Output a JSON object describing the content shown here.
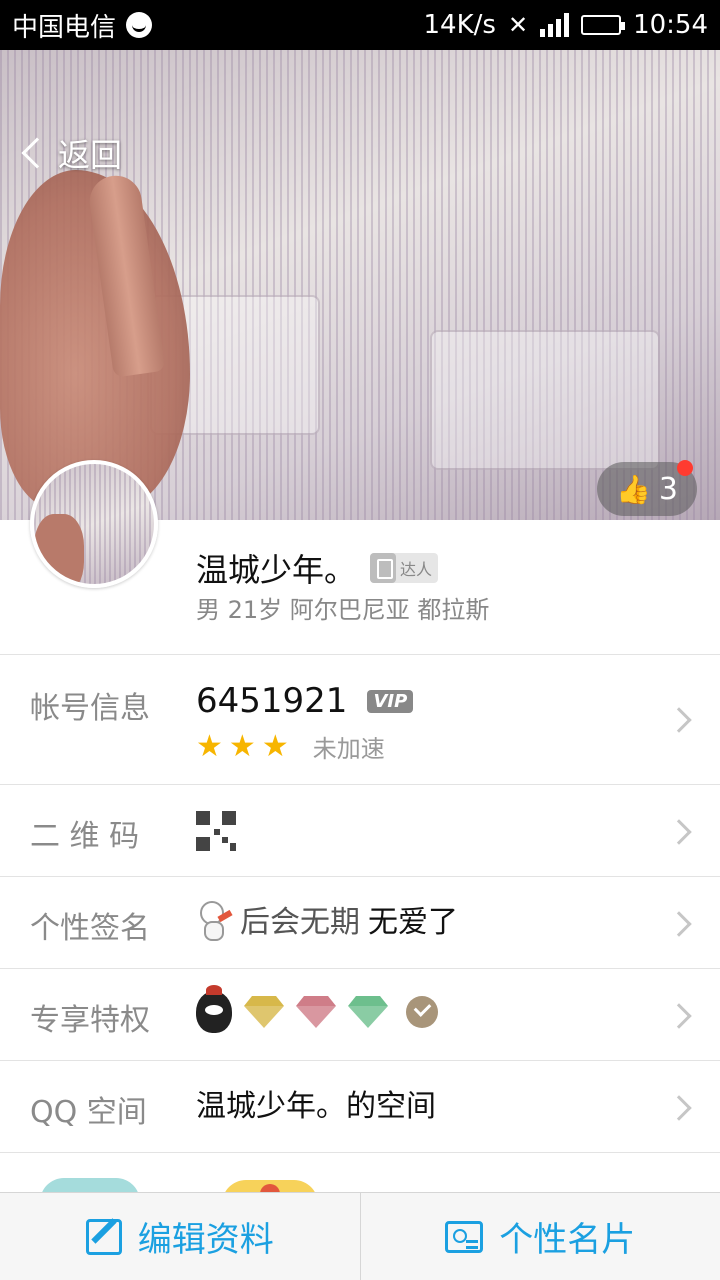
{
  "status_bar": {
    "carrier": "中国电信",
    "net_speed": "14K/s",
    "time": "10:54"
  },
  "header": {
    "back_label": "返回"
  },
  "cover": {
    "like_count": "3"
  },
  "profile": {
    "nickname": "温城少年。",
    "badge_label": "达人",
    "meta": "男 21岁 阿尔巴尼亚 都拉斯"
  },
  "list": {
    "account": {
      "label": "帐号信息",
      "number": "6451921",
      "vip_label": "VIP",
      "star_count": 3,
      "accel_status": "未加速"
    },
    "qrcode": {
      "label": "二 维 码"
    },
    "signature": {
      "label": "个性签名",
      "text_part1": "后会无期",
      "text_part2": "无爱了"
    },
    "privileges": {
      "label": "专享特权",
      "icons": [
        "penguin-icon",
        "gold-diamond-icon",
        "red-diamond-icon",
        "green-diamond-icon",
        "check-badge-icon"
      ]
    },
    "qzone": {
      "label": "QQ 空间",
      "value": "温城少年。的空间"
    }
  },
  "bottom_bar": {
    "edit_label": "编辑资料",
    "card_label": "个性名片"
  },
  "colors": {
    "accent": "#1ba0e1",
    "like_dot": "#ff3b30",
    "star": "#f7b500"
  }
}
